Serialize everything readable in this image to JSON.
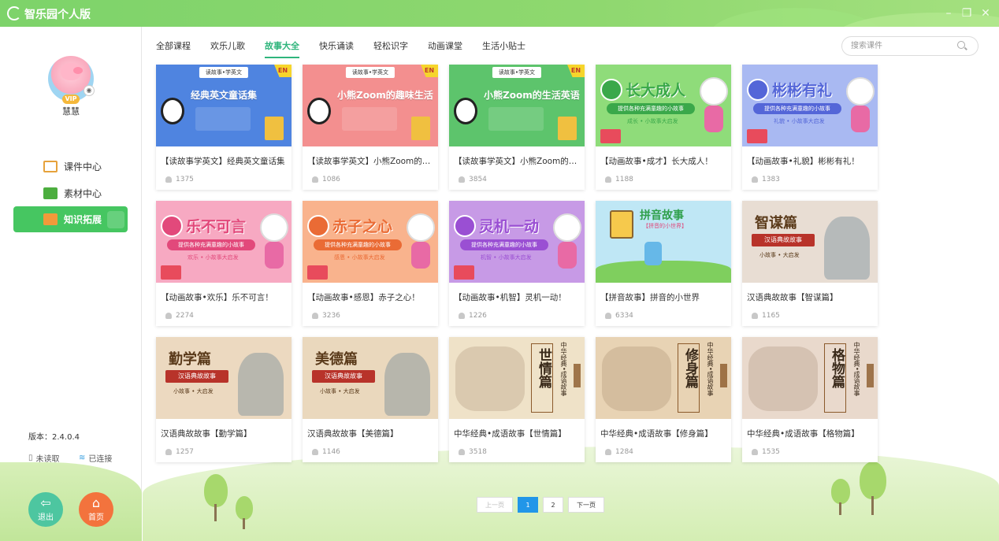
{
  "app": {
    "title": "智乐园个人版"
  },
  "user": {
    "name": "慧慧",
    "badge": "VIP"
  },
  "sidebar": {
    "items": [
      {
        "label": "课件中心",
        "icon": "courseware-icon",
        "active": false
      },
      {
        "label": "素材中心",
        "icon": "folder-icon",
        "active": false
      },
      {
        "label": "知识拓展",
        "icon": "knowledge-icon",
        "active": true
      }
    ],
    "version": "版本：2.4.0.4",
    "usb_status": "未读取",
    "net_status": "已连接",
    "logout_label": "退出",
    "home_label": "首页"
  },
  "tabs": [
    {
      "label": "全部课程",
      "active": false
    },
    {
      "label": "欢乐儿歌",
      "active": false
    },
    {
      "label": "故事大全",
      "active": true
    },
    {
      "label": "快乐诵读",
      "active": false
    },
    {
      "label": "轻松识字",
      "active": false
    },
    {
      "label": "动画课堂",
      "active": false
    },
    {
      "label": "生活小贴士",
      "active": false
    }
  ],
  "search": {
    "placeholder": "搜索课件"
  },
  "cards": [
    {
      "title": "【读故事学英文】经典英文童话集",
      "views": "1375",
      "thumb_tag": "读故事•学英文",
      "thumb_badge": "EN",
      "thumb_text": "经典英文童话集",
      "bg": "#4f84e0",
      "band": "#ffffff",
      "style": "en"
    },
    {
      "title": "【读故事学英文】小熊Zoom的趣味生活",
      "views": "1086",
      "thumb_tag": "读故事•学英文",
      "thumb_badge": "EN",
      "thumb_text": "小熊Zoom的趣味生活",
      "bg": "#f38f8f",
      "band": "#ffffff",
      "style": "en"
    },
    {
      "title": "【读故事学英文】小熊Zoom的生活英语",
      "views": "3854",
      "thumb_tag": "读故事•学英文",
      "thumb_badge": "EN",
      "thumb_text": "小熊Zoom的生活英语",
      "bg": "#5dc46c",
      "band": "#ffffff",
      "style": "en"
    },
    {
      "title": "【动画故事•成才】长大成人！",
      "views": "1188",
      "thumb_text": "长大成人",
      "thumb_sub": "提供各种充满童趣的小故事",
      "thumb_foot": "成长 • 小故事大启发",
      "bg": "#8fdc7a",
      "band": "#3aa84a",
      "style": "anim"
    },
    {
      "title": "【动画故事•礼貌】彬彬有礼！",
      "views": "1383",
      "thumb_text": "彬彬有礼",
      "thumb_sub": "提供各种充满童趣的小故事",
      "thumb_foot": "礼貌 • 小故事大启发",
      "bg": "#a9b9f2",
      "band": "#5466d8",
      "style": "anim"
    },
    {
      "title": "【动画故事•欢乐】乐不可言！",
      "views": "2274",
      "thumb_text": "乐不可言",
      "thumb_sub": "提供各种充满童趣的小故事",
      "thumb_foot": "欢乐 • 小故事大启发",
      "bg": "#f7a9c2",
      "band": "#e2497b",
      "style": "anim"
    },
    {
      "title": "【动画故事•感恩】赤子之心！",
      "views": "3236",
      "thumb_text": "赤子之心",
      "thumb_sub": "提供各种充满童趣的小故事",
      "thumb_foot": "感恩 • 小故事大启发",
      "bg": "#f9b38d",
      "band": "#ea6b35",
      "style": "anim"
    },
    {
      "title": "【动画故事•机智】灵机一动！",
      "views": "1226",
      "thumb_text": "灵机一动",
      "thumb_sub": "提供各种充满童趣的小故事",
      "thumb_foot": "机智 • 小故事大启发",
      "bg": "#c79ae6",
      "band": "#9a4fd3",
      "style": "anim"
    },
    {
      "title": "【拼音故事】拼音的小世界",
      "views": "6334",
      "thumb_text": "拼音故事",
      "thumb_sub": "【拼音的小世界】",
      "bg": "#bfe7f5",
      "band": "#7fcf5e",
      "style": "pinyin"
    },
    {
      "title": "汉语典故故事【智谋篇】",
      "views": "1165",
      "thumb_text": "智谋篇",
      "thumb_sub": "汉语典故故事",
      "thumb_foot": "小故事 • 大启发",
      "bg": "#e8ddd3",
      "band": "#b8332a",
      "style": "idiom"
    },
    {
      "title": "汉语典故故事【勤学篇】",
      "views": "1257",
      "thumb_text": "勤学篇",
      "thumb_sub": "汉语典故故事",
      "thumb_foot": "小故事 • 大启发",
      "bg": "#ecd9c0",
      "band": "#b8332a",
      "style": "idiom"
    },
    {
      "title": "汉语典故故事【美德篇】",
      "views": "1146",
      "thumb_text": "美德篇",
      "thumb_sub": "汉语典故故事",
      "thumb_foot": "小故事 • 大启发",
      "bg": "#ead8bd",
      "band": "#b8332a",
      "style": "idiom"
    },
    {
      "title": "中华经典•成语故事【世情篇】",
      "views": "3518",
      "thumb_text": "世情篇",
      "thumb_sub": "中华经典•成语故事",
      "bg": "#efe2c8",
      "band": "#8b5a2b",
      "style": "classic"
    },
    {
      "title": "中华经典•成语故事【修身篇】",
      "views": "1284",
      "thumb_text": "修身篇",
      "thumb_sub": "中华经典•成语故事",
      "bg": "#e8d3b4",
      "band": "#8b5a2b",
      "style": "classic"
    },
    {
      "title": "中华经典•成语故事【格物篇】",
      "views": "1535",
      "thumb_text": "格物篇",
      "thumb_sub": "中华经典•成语故事",
      "bg": "#e9d9cc",
      "band": "#8b5a2b",
      "style": "classic"
    }
  ],
  "pagination": {
    "prev": "上一页",
    "pages": [
      "1",
      "2"
    ],
    "current": "1",
    "next": "下一页"
  }
}
